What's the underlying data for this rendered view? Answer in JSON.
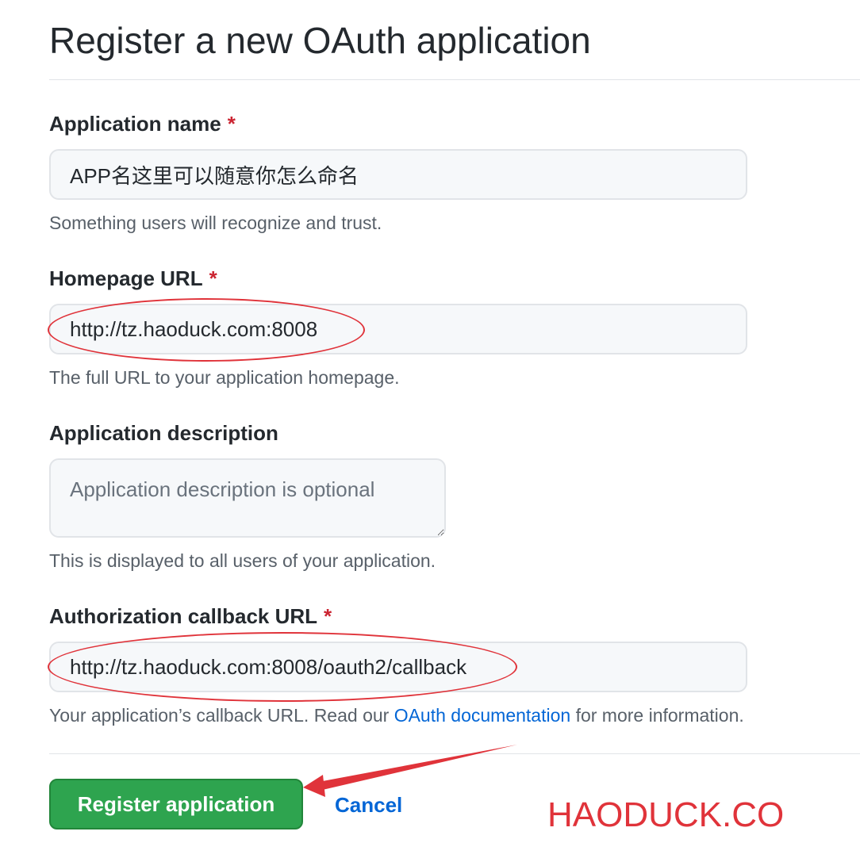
{
  "page": {
    "title": "Register a new OAuth application"
  },
  "form": {
    "app_name": {
      "label": "Application name",
      "required_mark": "*",
      "value": "APP名这里可以随意你怎么命名",
      "hint": "Something users will recognize and trust."
    },
    "homepage_url": {
      "label": "Homepage URL",
      "required_mark": "*",
      "value": "http://tz.haoduck.com:8008",
      "hint": "The full URL to your application homepage."
    },
    "description": {
      "label": "Application description",
      "placeholder": "Application description is optional",
      "hint": "This is displayed to all users of your application."
    },
    "callback_url": {
      "label": "Authorization callback URL",
      "required_mark": "*",
      "value": "http://tz.haoduck.com:8008/oauth2/callback",
      "hint_before": "Your application’s callback URL. Read our ",
      "hint_link": "OAuth documentation",
      "hint_after": " for more information."
    }
  },
  "actions": {
    "register_label": "Register application",
    "cancel_label": "Cancel"
  },
  "watermark": {
    "text": "HAODUCK.CO"
  },
  "colors": {
    "primary_button": "#2ea44f",
    "link": "#0366d6",
    "required": "#cb2431",
    "annotation": "#e0333a"
  }
}
